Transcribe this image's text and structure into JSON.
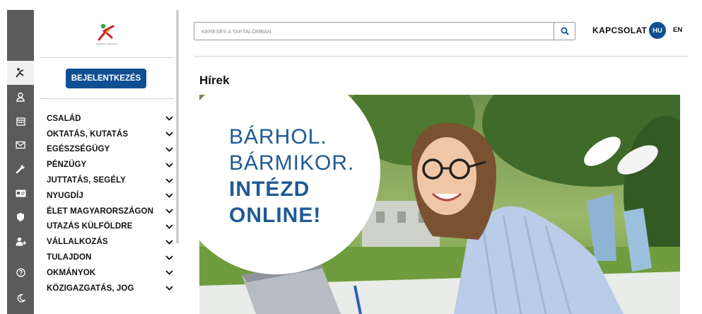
{
  "rail": {
    "items": [
      {
        "icon": "logo-figure-icon",
        "active": true
      },
      {
        "icon": "user-icon",
        "active": false
      },
      {
        "icon": "calendar-icon",
        "active": false
      },
      {
        "icon": "mail-icon",
        "active": false
      },
      {
        "icon": "wrench-icon",
        "active": false
      },
      {
        "icon": "id-card-icon",
        "active": false
      },
      {
        "icon": "shield-icon",
        "active": false
      },
      {
        "icon": "add-user-icon",
        "active": false
      },
      {
        "icon": "help-icon",
        "active": false
      },
      {
        "icon": "moon-icon",
        "active": false
      }
    ]
  },
  "sidebar": {
    "logo_caption": "egyablakos ügyintézés",
    "login_label": "BEJELENTKEZÉS",
    "menu": [
      "CSALÁD",
      "OKTATÁS, KUTATÁS",
      "EGÉSZSÉGÜGY",
      "PÉNZÜGY",
      "JUTTATÁS, SEGÉLY",
      "NYUGDÍJ",
      "ÉLET MAGYARORSZÁGON",
      "UTAZÁS KÜLFÖLDRE",
      "VÁLLALKOZÁS",
      "TULAJDON",
      "OKMÁNYOK",
      "KÖZIGAZGATÁS, JOG"
    ]
  },
  "header": {
    "search_placeholder": "KERESÉS A TARTALOMBAN",
    "contact": "KAPCSOLAT",
    "lang_active": "HU",
    "lang_other": "EN"
  },
  "main": {
    "title": "Hírek",
    "banner": {
      "line1": "BÁRHOL.",
      "line2": "BÁRMIKOR.",
      "line3": "INTÉZD",
      "line4": "ONLINE!"
    }
  },
  "colors": {
    "brand_blue": "#0f4f94",
    "banner_text": "#1e5a94",
    "rail_bg": "#5b5b5b"
  }
}
